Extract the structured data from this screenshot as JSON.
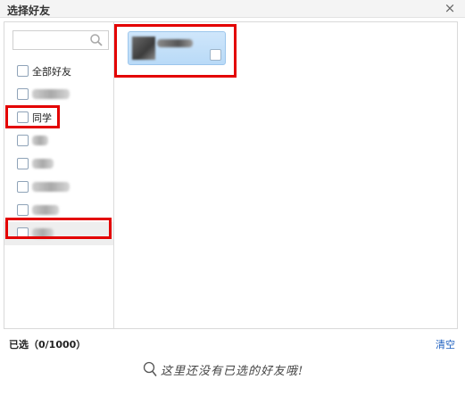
{
  "dialog": {
    "title": "选择好友",
    "close_glyph": "×"
  },
  "search": {
    "value": "",
    "placeholder": "",
    "icon": "search-icon"
  },
  "groups": [
    {
      "label": "全部好友",
      "blurred": false
    },
    {
      "label": "",
      "blurred": true
    },
    {
      "label": "同学",
      "blurred": false
    },
    {
      "label": "",
      "blurred": true
    },
    {
      "label": "",
      "blurred": true
    },
    {
      "label": "",
      "blurred": true
    },
    {
      "label": "",
      "blurred": true
    },
    {
      "label": "",
      "blurred": true
    }
  ],
  "friend_card": {
    "name": "",
    "checked": false
  },
  "footer": {
    "selected_label": "已选（0/1000）",
    "clear_label": "清空",
    "empty_message": "这里还没有已选的好友哦!"
  },
  "colors": {
    "highlight": "#e30000",
    "link": "#1d5fbf",
    "card_bg": "#c4e0f9"
  }
}
